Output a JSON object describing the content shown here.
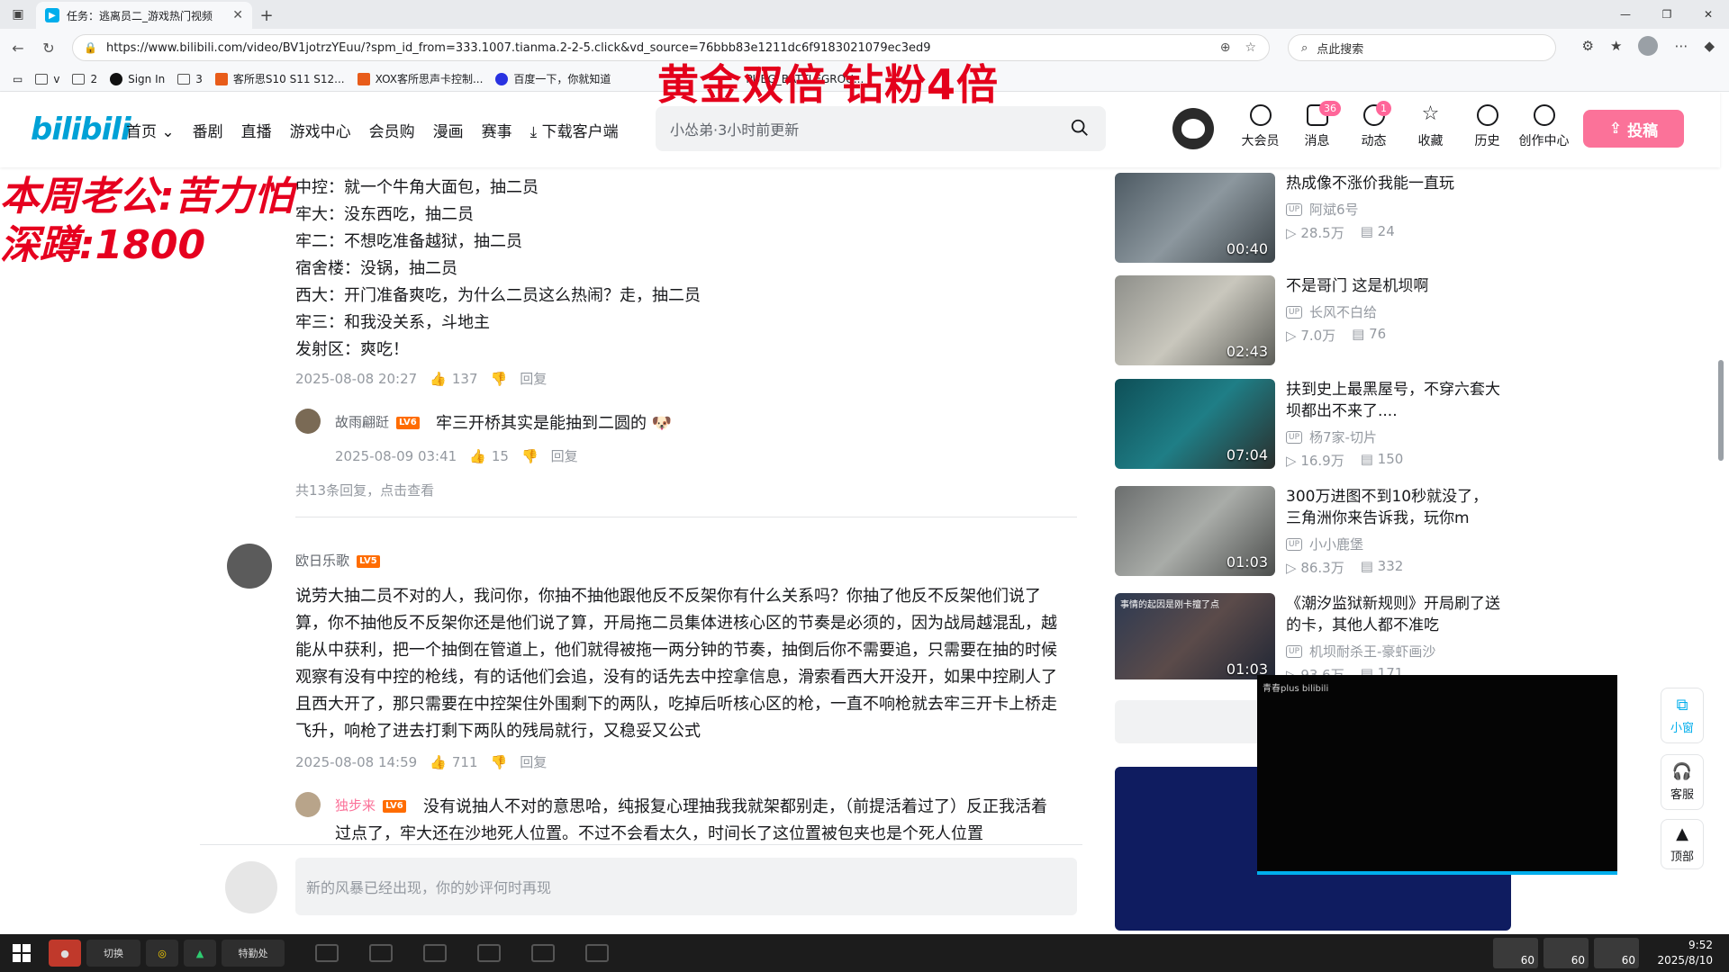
{
  "browser": {
    "tab_title": "任务：逃离员二_游戏热门视频",
    "url": "https://www.bilibili.com/video/BV1jotrzYEuu/?spm_id_from=333.1007.tianma.2-2-5.click&vd_source=76bbb83e1211dc6f9183021079ec3ed9",
    "search_placeholder": "点此搜索",
    "bookmarks": [
      "v",
      "2",
      "Sign In",
      "3",
      "客所思S10 S11 S12...",
      "XOX客所思声卡控制...",
      "百度一下，你就知道",
      "PUBG_BATTLEGROU..."
    ]
  },
  "overlay": {
    "title": "黄金双倍 钻粉4倍",
    "streamer_line1": "本周老公:苦力怕",
    "streamer_line2": "深蹲:1800"
  },
  "header": {
    "logo": "bilibili",
    "nav": [
      "首页",
      "番剧",
      "直播",
      "游戏中心",
      "会员购",
      "漫画",
      "赛事",
      "下载客户端"
    ],
    "search_placeholder": "小怂弟·3小时前更新",
    "icons": [
      {
        "label": "大会员",
        "badge": ""
      },
      {
        "label": "消息",
        "badge": "36"
      },
      {
        "label": "动态",
        "badge": "1"
      },
      {
        "label": "收藏",
        "badge": ""
      },
      {
        "label": "历史",
        "badge": ""
      },
      {
        "label": "创作中心",
        "badge": ""
      }
    ],
    "upload": "投稿"
  },
  "comment1": {
    "lines": [
      "中控：就一个牛角大面包，抽二员",
      "牢大：没东西吃，抽二员",
      "牢二：不想吃准备越狱，抽二员",
      "宿舍楼：没锅，抽二员",
      "西大：开门准备爽吃，为什么二员这么热闹？走，抽二员",
      "牢三：和我没关系，斗地主",
      "发射区：爽吃！"
    ],
    "time": "2025-08-08 20:27",
    "likes": "137",
    "reply": "回复",
    "sub": {
      "user": "故雨翩跹",
      "level": "LV6",
      "text": "牢三开桥其实是能抽到二圆的",
      "time": "2025-08-09 03:41",
      "likes": "15",
      "reply": "回复"
    },
    "more": "共13条回复，点击查看"
  },
  "comment2": {
    "user": "欧日乐歌",
    "level": "LV5",
    "text": "说劳大抽二员不对的人，我问你，你抽不抽他跟他反不反架你有什么关系吗？你抽了他反不反架他们说了算，你不抽他反不反架你还是他们说了算，开局拖二员集体进核心区的节奏是必须的，因为战局越混乱，越能从中获利，把一个抽倒在管道上，他们就得被拖一两分钟的节奏，抽倒后你不需要追，只需要在抽的时候观察有没有中控的枪线，有的话他们会追，没有的话先去中控拿信息，滑索看西大开没开，如果中控刷人了且西大开了，那只需要在中控架住外围剩下的两队，吃掉后听核心区的枪，一直不响枪就去牢三开卡上桥走飞升，响枪了进去打剩下两队的残局就行，又稳妥又公式",
    "time": "2025-08-08 14:59",
    "likes": "711",
    "reply": "回复",
    "sub": {
      "user": "独步来",
      "level": "LV6",
      "text1": "没有说抽人不对的意思哈，纯报复心理抽我我就架都别走，（前提活着过了）反正我活着",
      "text2": "过点了，牢大还在沙地死人位置。不过不会看太久，时间长了这位置被包夹也是个死人位置"
    }
  },
  "reply_box": {
    "placeholder": "新的风暴已经出现，你的妙评何时再现"
  },
  "recommendations": [
    {
      "title": "热成像不涨价我能一直玩",
      "up": "阿斌6号",
      "views": "28.5万",
      "danmaku": "24",
      "duration": "00:40"
    },
    {
      "title": "不是哥门 这是机坝啊",
      "up": "长风不白给",
      "views": "7.0万",
      "danmaku": "76",
      "duration": "02:43"
    },
    {
      "title": "扶到史上最黑屋号，不穿六套大坝都出不来了....",
      "up": "杨7家-切片",
      "views": "16.9万",
      "danmaku": "150",
      "duration": "07:04"
    },
    {
      "title": "300万进图不到10秒就没了，三角洲你来告诉我，玩你m",
      "up": "小小鹿堡",
      "views": "86.3万",
      "danmaku": "332",
      "duration": "01:03"
    },
    {
      "title": "《潮汐监狱新规则》开局刷了送的卡，其他人都不准吃",
      "up": "机坝耐杀王-豪虾画沙",
      "views": "93.6万",
      "danmaku": "171",
      "duration": "01:03"
    }
  ],
  "thumb_caption": "事情的起因是刚卡擅了点",
  "miniplayer_brand": "青春plus bilibili",
  "side_buttons": [
    "小窗",
    "客服",
    "顶部"
  ],
  "taskbar": {
    "apps": [
      "切换",
      "特勤处"
    ],
    "tray": [
      "60",
      "60",
      "60"
    ],
    "time": "9:52",
    "date": "2025/8/10"
  },
  "colors": {
    "accent": "#00aeec",
    "pink": "#fb7299",
    "overlay_red": "#e4001b"
  }
}
